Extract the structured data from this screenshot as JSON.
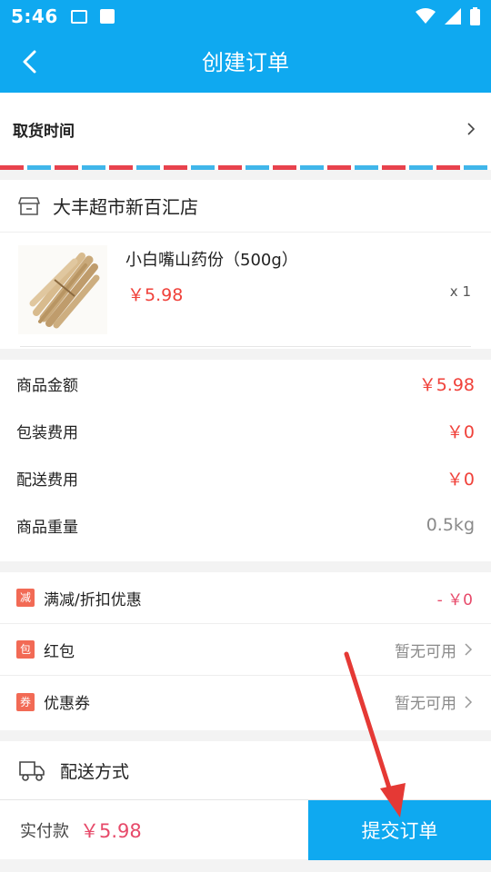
{
  "status_bar": {
    "time": "5:46"
  },
  "header": {
    "title": "创建订单"
  },
  "pickup": {
    "label": "取货时间"
  },
  "store": {
    "name": "大丰超市新百汇店",
    "item": {
      "name": "小白嘴山药份（500g）",
      "price": "￥5.98",
      "qty": "x 1"
    }
  },
  "fees": [
    {
      "label": "商品金额",
      "value": "￥5.98"
    },
    {
      "label": "包装费用",
      "value": "￥0"
    },
    {
      "label": "配送费用",
      "value": "￥0"
    },
    {
      "label": "商品重量",
      "value": "0.5kg"
    }
  ],
  "discounts": {
    "full_reduction": {
      "tag": "减",
      "label": "满减/折扣优惠",
      "value": "- ￥0"
    },
    "red_packet": {
      "tag": "包",
      "label": "红包",
      "value": "暂无可用"
    },
    "coupon": {
      "tag": "券",
      "label": "优惠券",
      "value": "暂无可用"
    }
  },
  "shipping": {
    "label": "配送方式"
  },
  "footer": {
    "paid_label": "实付款",
    "paid_amount": "￥5.98",
    "submit_label": "提交订单"
  },
  "colors": {
    "primary": "#0fa9f0",
    "price_red": "#f0413a",
    "pink": "#e74a6a",
    "tag": "#f26a55",
    "annotation": "#e53935"
  }
}
